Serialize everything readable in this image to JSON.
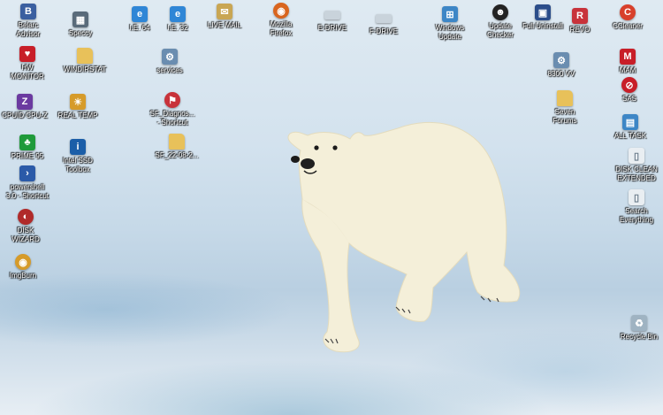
{
  "icons": [
    {
      "id": "belarc-advisor",
      "label": "Belarc\nAdvisor",
      "glyph": "B",
      "color": "#3a5fa0"
    },
    {
      "id": "speccy",
      "label": "Speccy",
      "glyph": "▦",
      "color": "#5a6b7a"
    },
    {
      "id": "ie64",
      "label": "I.E. 64",
      "glyph": "e",
      "color": "#2f86d6"
    },
    {
      "id": "ie32",
      "label": "I.E. 32",
      "glyph": "e",
      "color": "#2f86d6"
    },
    {
      "id": "live-mail",
      "label": "LIVE MAIL",
      "glyph": "✉",
      "color": "#c9a653"
    },
    {
      "id": "mozilla-firefox",
      "label": "Mozilla\nFirefox",
      "glyph": "◉",
      "color": "#d9651e"
    },
    {
      "id": "e-drive",
      "label": "E-DRIVE",
      "glyph": "",
      "color": "#c9d3db"
    },
    {
      "id": "f-drive",
      "label": "F-DRIVE",
      "glyph": "",
      "color": "#c9d3db"
    },
    {
      "id": "windows-update",
      "label": "Windows\nUpdate",
      "glyph": "⊞",
      "color": "#3d86c6"
    },
    {
      "id": "update-checker",
      "label": "Update\nChecker",
      "glyph": "☻",
      "color": "#222222"
    },
    {
      "id": "full-uninstall",
      "label": "Full Uninstall",
      "glyph": "▣",
      "color": "#2b4d8a"
    },
    {
      "id": "revo",
      "label": "REVO",
      "glyph": "R",
      "color": "#c8323a"
    },
    {
      "id": "ccleaner",
      "label": "CCleaner",
      "glyph": "C",
      "color": "#d8402b"
    },
    {
      "id": "hw-monitor",
      "label": "HW\nMONITOR",
      "glyph": "♥",
      "color": "#c81e28"
    },
    {
      "id": "windirstat",
      "label": "WINDIRSTAT",
      "glyph": "",
      "color": "#e8c15a"
    },
    {
      "id": "services",
      "label": "services",
      "glyph": "⚙",
      "color": "#6a8db0"
    },
    {
      "id": "8300-vv",
      "label": "8300 VV",
      "glyph": "⚙",
      "color": "#6a8db0"
    },
    {
      "id": "mam",
      "label": "MAM",
      "glyph": "M",
      "color": "#c81e28"
    },
    {
      "id": "cpuid-cpu-z",
      "label": "CPUID CPU-Z",
      "glyph": "Z",
      "color": "#6b3aa0"
    },
    {
      "id": "real-temp",
      "label": "REAL TEMP",
      "glyph": "☀",
      "color": "#d69b2a"
    },
    {
      "id": "sf-diagnostic",
      "label": "SF_Diagnos...\n- Shortcut",
      "glyph": "⚑",
      "color": "#c8323a"
    },
    {
      "id": "seven-forums",
      "label": "Seven\nForums",
      "glyph": "",
      "color": "#e8c15a"
    },
    {
      "id": "sas",
      "label": "SAS",
      "glyph": "⊘",
      "color": "#c81e28"
    },
    {
      "id": "all-task",
      "label": "ALL TASK",
      "glyph": "▤",
      "color": "#3d86c6"
    },
    {
      "id": "prime95",
      "label": "PRIME 95",
      "glyph": "♣",
      "color": "#1f9a3a"
    },
    {
      "id": "intel-ssd-toolbox",
      "label": "Intel SSD\nToolbox",
      "glyph": "i",
      "color": "#1b5ea8"
    },
    {
      "id": "sf-folder",
      "label": "SF_22-08-2...",
      "glyph": "",
      "color": "#e8c15a"
    },
    {
      "id": "disk-clean-extended",
      "label": "DISK CLEAN\nEXTENDED",
      "glyph": "▯",
      "color": "#e9eef2"
    },
    {
      "id": "powershell",
      "label": "powershell\n3.0 - Shortcut",
      "glyph": "›",
      "color": "#2b5aa8"
    },
    {
      "id": "search-everything",
      "label": "Search\nEverything",
      "glyph": "▯",
      "color": "#e9eef2"
    },
    {
      "id": "disk-wizard",
      "label": "DISK\nWIZARD",
      "glyph": "◐",
      "color": "#b02a2a"
    },
    {
      "id": "imgburn",
      "label": "ImgBurn",
      "glyph": "◉",
      "color": "#d69b2a"
    },
    {
      "id": "recycle-bin",
      "label": "Recycle Bin",
      "glyph": "♻",
      "color": "#9fb3c2"
    }
  ]
}
